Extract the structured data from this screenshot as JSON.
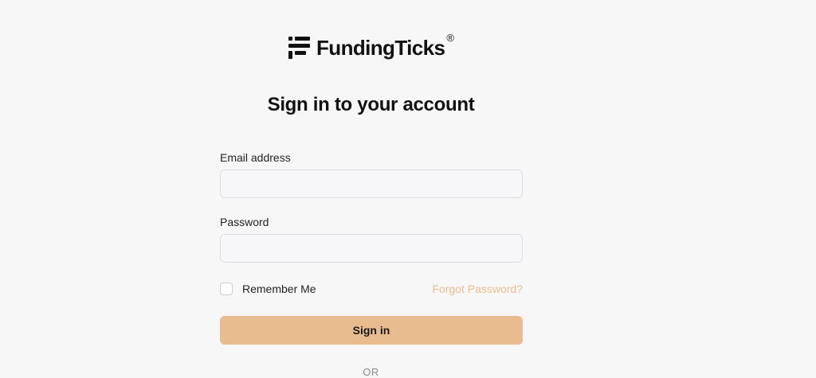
{
  "brand": {
    "name": "FundingTicks",
    "registered_mark": "®",
    "logo_icon": "fundingticks-logo-icon"
  },
  "heading": "Sign in to your account",
  "form": {
    "email_label": "Email address",
    "email_value": "",
    "password_label": "Password",
    "password_value": "",
    "remember_label": "Remember Me",
    "remember_checked": false,
    "forgot_link": "Forgot Password?",
    "submit_label": "Sign in",
    "divider_text": "OR"
  },
  "colors": {
    "background": "#f7f7f8",
    "accent": "#e8bc8f",
    "link": "#e9bc8d",
    "text": "#111111"
  }
}
